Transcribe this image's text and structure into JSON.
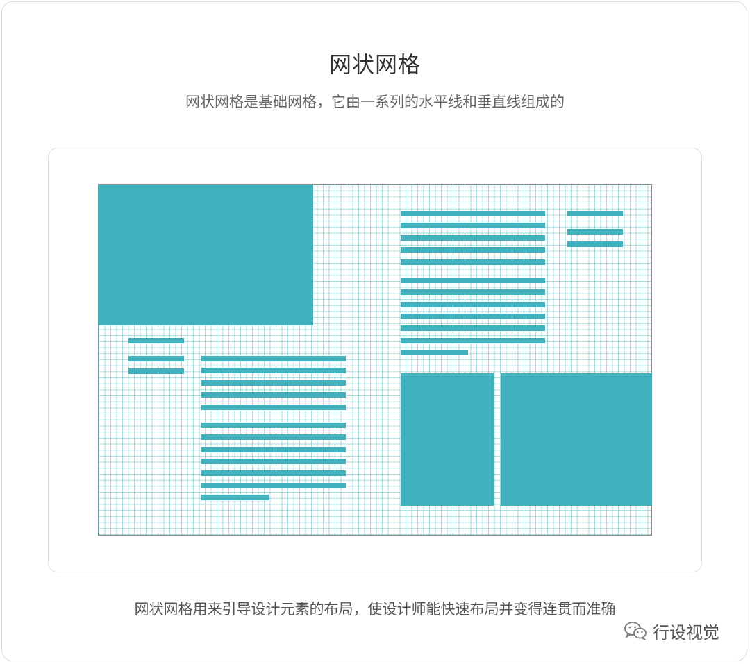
{
  "title": "网状网格",
  "subtitle": "网状网格是基础网格，它由一系列的水平线和垂直线组成的",
  "caption": "网状网格用来引导设计元素的布局，使设计师能快速布局并变得连贯而准确",
  "watermark": {
    "icon": "wechat-icon",
    "text": "行设视觉"
  },
  "colors": {
    "accent": "#42b1be",
    "grid_line": "#62bec4",
    "frame": "#888888"
  }
}
